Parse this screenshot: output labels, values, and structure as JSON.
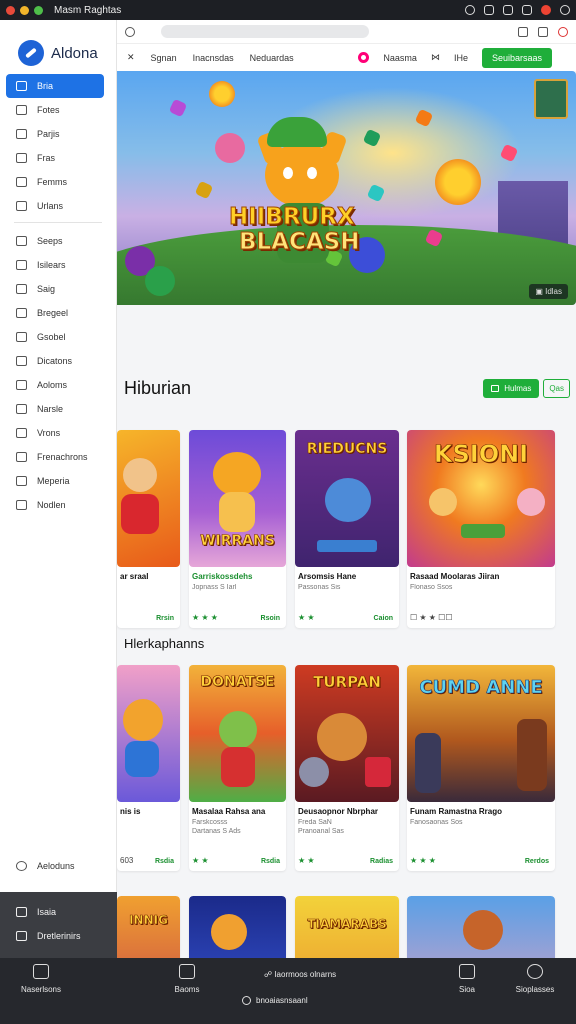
{
  "statusbar": {
    "title": "Masm Raghtas"
  },
  "sidebar": {
    "brand": "Aldona",
    "items": [
      {
        "label": "Bria",
        "active": true
      },
      {
        "label": "Fotes"
      },
      {
        "label": "Parjis"
      },
      {
        "label": "Fras"
      },
      {
        "label": "Femms"
      },
      {
        "label": "Urlans"
      }
    ],
    "items2": [
      {
        "label": "Seeps"
      },
      {
        "label": "Isilears"
      },
      {
        "label": "Saig"
      },
      {
        "label": "Bregeel"
      },
      {
        "label": "Gsobel"
      },
      {
        "label": "Dicatons"
      },
      {
        "label": "Aoloms"
      },
      {
        "label": "Narsle"
      },
      {
        "label": "Vrons"
      },
      {
        "label": "Frenachrons"
      },
      {
        "label": "Meperia"
      },
      {
        "label": "Nodlen"
      }
    ],
    "footer_item": "Aeloduns",
    "dark_items": [
      {
        "label": "Isaia"
      },
      {
        "label": "Dretlerinirs"
      }
    ]
  },
  "topnav": {
    "links": [
      "Sgnan",
      "Inacnsdas",
      "Neduardas"
    ],
    "right_links": [
      "Naasma",
      "IHe"
    ],
    "cta": "Seuibarsaas"
  },
  "hero": {
    "title_line1": "HIIBRURX",
    "title_line2": "BLACASH",
    "tag": "Idlas"
  },
  "section1": {
    "title": "Hiburian",
    "btn_primary": "Hulmas",
    "btn_secondary": "Qas",
    "cards": [
      {
        "art_title": "",
        "t1": "ar sraal",
        "t1_green": false,
        "t2": "",
        "t3": "",
        "rate": "",
        "free": "Rrsin"
      },
      {
        "art_title": "WIRRANS",
        "t1": "Garriskossdehs",
        "t1_green": true,
        "t2": "Jopnass S Iarl",
        "t3": "",
        "rate": "★ ★ ★",
        "free": "Rsoin"
      },
      {
        "art_title": "RIEDUCNS",
        "t1": "Arsomsis Hane",
        "t1_green": false,
        "t2": "Passonas Sis",
        "t3": "",
        "rate": "★ ★",
        "free": "Caion"
      },
      {
        "art_title": "KSIONI",
        "t1": "Rasaad Moolaras Jiiran",
        "t1_green": false,
        "t2": "Flonaso Ssos",
        "t3": "",
        "rate": "☐ ★ ★  ☐☐",
        "free": ""
      }
    ]
  },
  "section2": {
    "title": "Hlerkaphanns",
    "cards": [
      {
        "art_title": "",
        "t1": "nis is",
        "t1_green": false,
        "t2": "",
        "t3": "",
        "rate": "603",
        "free": "Rsdia"
      },
      {
        "art_title": "DONATSE",
        "t1": "Masalaa Rahsa ana",
        "t1_green": false,
        "t2": "Farskcosss",
        "t3": "Dartanas S Ads",
        "rate": "★ ★",
        "free": "Rsdia"
      },
      {
        "art_title": "TURPAN",
        "t1": "Deusaopnor Nbrphar",
        "t1_green": false,
        "t2": "Freda SaN",
        "t3": "Pranoanal Sas",
        "rate": "★ ★",
        "free": "Radias"
      },
      {
        "art_title": "CUMD ANNE",
        "t1": "Funam Ramastna Rrago",
        "t1_green": false,
        "t2": "Fanosaonas Sos",
        "t3": "",
        "rate": "★ ★ ★",
        "free": "Rerdos"
      }
    ]
  },
  "section3": {
    "cards": [
      {
        "art_title": "INNIG"
      },
      {
        "art_title": ""
      },
      {
        "art_title": "TIAMARABS"
      },
      {
        "art_title": ""
      }
    ]
  },
  "bottombar": {
    "items": [
      "Naserlsons",
      "Baoms",
      "Sioa",
      "Sioplasses"
    ],
    "middle": "Iaormoos olnarns",
    "url": "bnoaiasnsaanl"
  }
}
